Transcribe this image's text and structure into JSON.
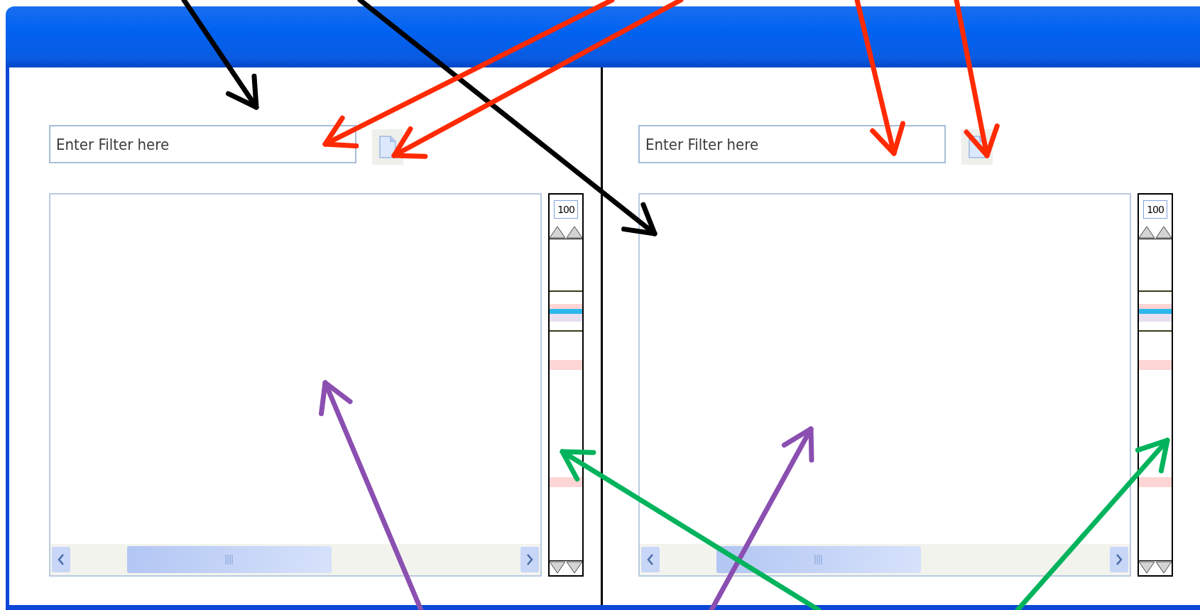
{
  "panes": [
    {
      "filter": {
        "placeholder": "Enter Filter here"
      },
      "zoom_value": "100"
    },
    {
      "filter": {
        "placeholder": "Enter Filter here"
      },
      "zoom_value": "100"
    }
  ]
}
